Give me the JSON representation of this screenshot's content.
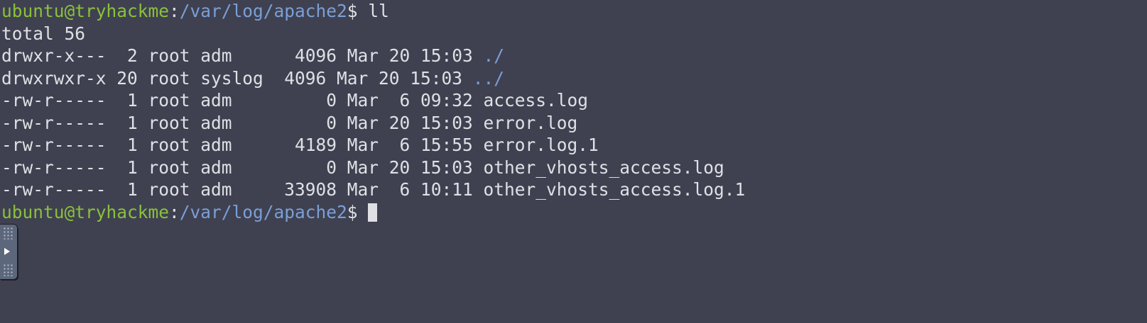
{
  "colors": {
    "background": "#3f4151",
    "text": "#dfe0e4",
    "user_host": "#8ac13a",
    "path": "#7b9fd6"
  },
  "prompt1": {
    "user_host": "ubuntu@tryhackme",
    "sep": ":",
    "path": "/var/log/apache2",
    "symbol": "$ ",
    "command": "ll"
  },
  "total_line": "total 56",
  "entries": [
    {
      "meta": "drwxr-x---  2 root adm      4096 Mar 20 15:03 ",
      "name": "./",
      "is_dir": true
    },
    {
      "meta": "drwxrwxr-x 20 root syslog  4096 Mar 20 15:03 ",
      "name": "../",
      "is_dir": true
    },
    {
      "meta": "-rw-r-----  1 root adm         0 Mar  6 09:32 ",
      "name": "access.log",
      "is_dir": false
    },
    {
      "meta": "-rw-r-----  1 root adm         0 Mar 20 15:03 ",
      "name": "error.log",
      "is_dir": false
    },
    {
      "meta": "-rw-r-----  1 root adm      4189 Mar  6 15:55 ",
      "name": "error.log.1",
      "is_dir": false
    },
    {
      "meta": "-rw-r-----  1 root adm         0 Mar 20 15:03 ",
      "name": "other_vhosts_access.log",
      "is_dir": false
    },
    {
      "meta": "-rw-r-----  1 root adm     33908 Mar  6 10:11 ",
      "name": "other_vhosts_access.log.1",
      "is_dir": false
    }
  ],
  "prompt2": {
    "user_host": "ubuntu@tryhackme",
    "sep": ":",
    "path": "/var/log/apache2",
    "symbol": "$ "
  },
  "side_panel": {
    "icon": "expand-arrow-icon"
  }
}
